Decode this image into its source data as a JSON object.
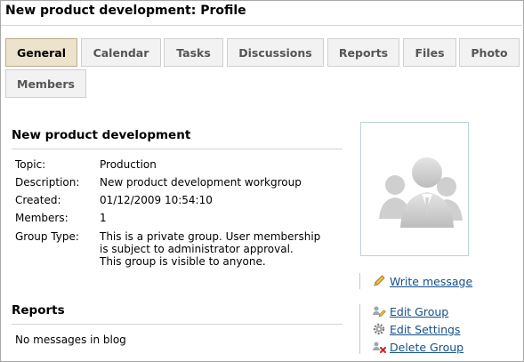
{
  "page": {
    "title": "New product development: Profile"
  },
  "tabs": [
    {
      "label": "General",
      "active": true
    },
    {
      "label": "Calendar"
    },
    {
      "label": "Tasks"
    },
    {
      "label": "Discussions"
    },
    {
      "label": "Reports"
    },
    {
      "label": "Files"
    },
    {
      "label": "Photo"
    },
    {
      "label": "Members"
    }
  ],
  "group": {
    "name": "New product development",
    "details": [
      {
        "label": "Topic:",
        "value": "Production"
      },
      {
        "label": "Description:",
        "value": "New product development workgroup"
      },
      {
        "label": "Created:",
        "value": "01/12/2009 10:54:10"
      },
      {
        "label": "Members:",
        "value": "1"
      },
      {
        "label": "Group Type:",
        "value_lines": [
          "This is a private group. User membership",
          "is subject to administrator approval.",
          "This group is visible to anyone."
        ]
      }
    ]
  },
  "reports": {
    "title": "Reports",
    "empty_text": "No messages in blog"
  },
  "actions": {
    "write_message": "Write message",
    "edit_group": "Edit Group",
    "edit_settings": "Edit Settings",
    "delete_group": "Delete Group"
  },
  "icons": {
    "photo_placeholder": "group-avatar-icon",
    "write_message": "pencil-icon",
    "edit_group": "edit-group-icon",
    "edit_settings": "gear-icon",
    "delete_group": "delete-group-icon"
  },
  "colors": {
    "active_tab": "#ede3cc",
    "tab": "#f2f2f2",
    "link": "#14508a"
  }
}
